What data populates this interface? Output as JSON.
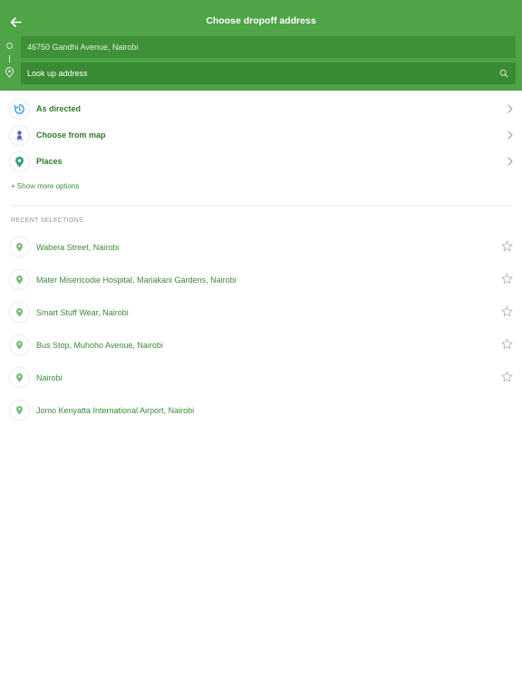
{
  "header": {
    "title": "Choose dropoff address",
    "back_icon": "back-arrow-icon"
  },
  "route": {
    "origin_value": "46750 Gandhi Avenue,  Nairobi",
    "destination_placeholder": "Look up address",
    "destination_value": ""
  },
  "options": [
    {
      "label": "As directed",
      "icon": "as-directed-icon"
    },
    {
      "label": "Choose from map",
      "icon": "map-person-icon"
    },
    {
      "label": "Places",
      "icon": "places-pin-icon"
    }
  ],
  "show_more_label": "+ Show more options",
  "recent_header": "RECENT SELECTIONS",
  "recent": [
    {
      "label": "Wabera Street,  Nairobi",
      "starred": false
    },
    {
      "label": "Mater Misericodie Hospital, Mariakani Gardens,  Nairobi",
      "starred": false
    },
    {
      "label": "Smart Stuff Wear,  Nairobi",
      "starred": false
    },
    {
      "label": "Bus Stop, Muhoho Avenue,  Nairobi",
      "starred": false
    },
    {
      "label": "Nairobi",
      "starred": false
    },
    {
      "label": "Jomo Kenyatta International Airport,  Nairobi"
    }
  ],
  "colors": {
    "header_green": "#4ea447",
    "accent_green": "#3e8a38",
    "blue_icon": "#2e9bd6",
    "purple_icon": "#5a5fc2",
    "teal_pin": "#33a584"
  }
}
